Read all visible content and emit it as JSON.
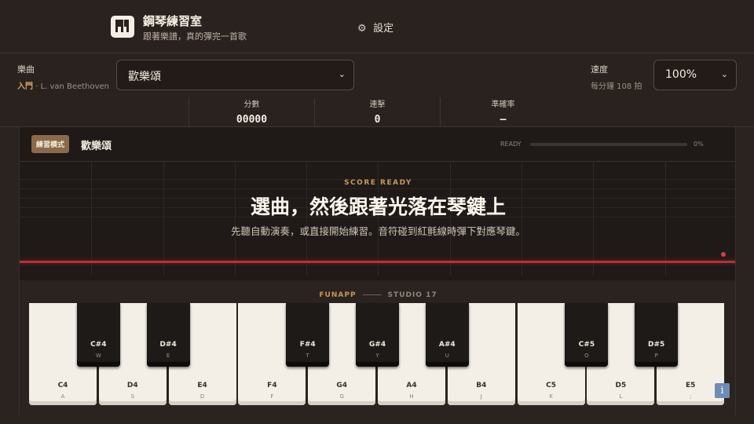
{
  "header": {
    "app_title": "鋼琴練習室",
    "app_subtitle": "跟著樂譜，真的彈完一首歌",
    "settings_label": "設定"
  },
  "controls": {
    "song_label": "樂曲",
    "song_level": "入門",
    "song_dot": "·",
    "song_composer": "L. van Beethoven",
    "song_selected": "歡樂頌",
    "speed_label": "速度",
    "speed_sub": "每分鐘 108 拍",
    "speed_selected": "100%"
  },
  "stats": [
    {
      "label": "分數",
      "value": "00000"
    },
    {
      "label": "連擊",
      "value": "0"
    },
    {
      "label": "準確率",
      "value": "—"
    }
  ],
  "stage": {
    "mode_badge": "練習模式",
    "title": "歡樂頌",
    "ready_label": "READY",
    "progress_percent": 0,
    "progress_text": "0%",
    "eyebrow": "SCORE READY",
    "headline": "選曲，然後跟著光落在琴鍵上",
    "description": "先聽自動演奏，或直接開始練習。音符碰到紅氈線時彈下對應琴鍵。"
  },
  "keyboard": {
    "brand_left": "FUNAPP",
    "brand_right": "STUDIO 17",
    "white_keys": [
      {
        "note": "C4",
        "key": "A"
      },
      {
        "note": "D4",
        "key": "S"
      },
      {
        "note": "E4",
        "key": "D"
      },
      {
        "note": "F4",
        "key": "F"
      },
      {
        "note": "G4",
        "key": "G"
      },
      {
        "note": "A4",
        "key": "H"
      },
      {
        "note": "B4",
        "key": "J"
      },
      {
        "note": "C5",
        "key": "K"
      },
      {
        "note": "D5",
        "key": "L"
      },
      {
        "note": "E5",
        "key": ";"
      }
    ],
    "black_keys": [
      {
        "note": "C#4",
        "key": "W"
      },
      {
        "note": "D#4",
        "key": "E"
      },
      {
        "note": "F#4",
        "key": "T"
      },
      {
        "note": "G#4",
        "key": "Y"
      },
      {
        "note": "A#4",
        "key": "U"
      },
      {
        "note": "C#5",
        "key": "O"
      },
      {
        "note": "D#5",
        "key": "P"
      }
    ]
  },
  "icons": {
    "logo": "piano-logo-icon",
    "settings": "gear-icon",
    "dropdown": "chevron-down-icon",
    "info": "info-icon"
  },
  "colors": {
    "accent": "#c9a05d",
    "hit_line": "#b2323c",
    "background": "#2b2320"
  }
}
